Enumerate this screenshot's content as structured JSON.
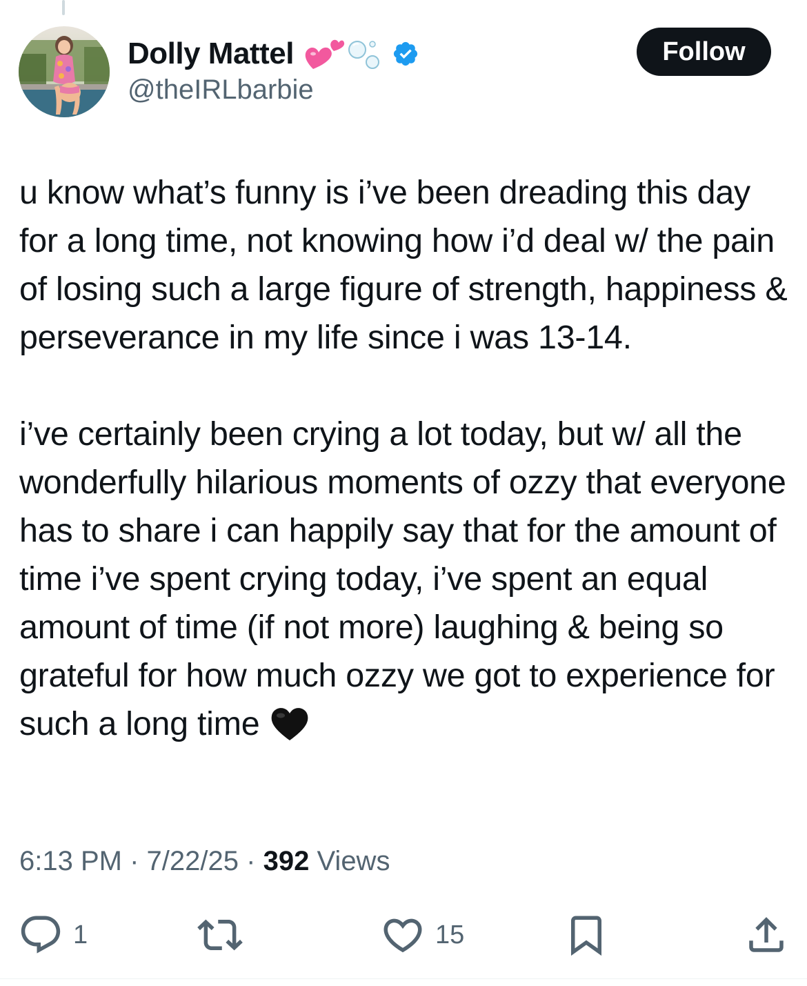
{
  "author": {
    "display_name": "Dolly Mattel",
    "handle": "@theIRLbarbie",
    "verified": true,
    "name_emojis": [
      "two-hearts-emoji",
      "bubbles-emoji"
    ]
  },
  "follow_button": {
    "label": "Follow"
  },
  "tweet": {
    "paragraphs": [
      "u know what’s funny is i’ve been dreading this day for a long time, not knowing how i’d deal w/ the pain of losing such a large figure of strength, happiness & perseverance in my life since i was 13-14.",
      "i’ve certainly been crying a lot today, but w/ all the wonderfully hilarious moments of ozzy that everyone has to share i can happily say that for the amount of time i’ve spent crying today, i’ve spent an equal amount of time (if not more) laughing & being so grateful for how much ozzy we got to experience for such a long time"
    ],
    "trailing_emoji": "black-heart-emoji"
  },
  "meta": {
    "time": "6:13 PM",
    "separator": "·",
    "date": "7/22/25",
    "views_count": "392",
    "views_label": "Views"
  },
  "actions": {
    "reply_count": "1",
    "repost_count": "",
    "like_count": "15"
  },
  "colors": {
    "text_primary": "#0f1419",
    "text_secondary": "#536471",
    "verified_blue": "#1d9bf0",
    "follow_bg": "#0f1419",
    "heart_pink": "#f2599e"
  }
}
